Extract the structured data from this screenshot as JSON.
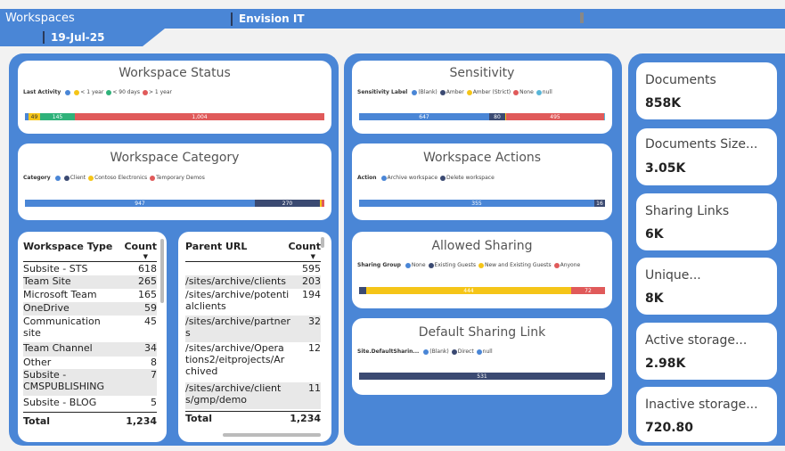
{
  "header": {
    "title": "Workspaces",
    "org": "Envision IT",
    "date": "19-Jul-25"
  },
  "colors": {
    "blue": "#4a86d6",
    "navy": "#3b4a72",
    "yellow": "#f5c518",
    "green": "#2fb27a",
    "red": "#e05a5a",
    "teal": "#58b6d8"
  },
  "workspace_status": {
    "title": "Workspace Status",
    "legend_label": "Last Activity",
    "legend_items": [
      "",
      "< 1 year",
      "< 90 days",
      "> 1 year"
    ],
    "bar_labels": [
      "49",
      "145",
      "1,004"
    ]
  },
  "workspace_category": {
    "title": "Workspace Category",
    "legend_label": "Category",
    "legend_items": [
      "",
      "Client",
      "Contoso Electronics",
      "Temporary Demos"
    ],
    "bar_labels": [
      "947",
      "270"
    ]
  },
  "sensitivity": {
    "title": "Sensitivity",
    "legend_label": "Sensitivity Label",
    "legend_items": [
      "(Blank)",
      "Amber",
      "Amber (Strict)",
      "None",
      "null"
    ],
    "bar_labels": [
      "647",
      "80",
      "495"
    ]
  },
  "workspace_actions": {
    "title": "Workspace Actions",
    "legend_label": "Action",
    "legend_items": [
      "Archive workspace",
      "Delete workspace"
    ],
    "bar_labels": [
      "355",
      "16"
    ]
  },
  "allowed_sharing": {
    "title": "Allowed Sharing",
    "legend_label": "Sharing Group",
    "legend_items": [
      "None",
      "Existing Guests",
      "New and Existing Guests",
      "Anyone"
    ],
    "bar_labels": [
      "444",
      "72"
    ]
  },
  "default_sharing": {
    "title": "Default Sharing Link",
    "legend_label": "Site.DefaultSharin...",
    "legend_items": [
      "(Blank)",
      "Direct",
      "null"
    ],
    "bar_labels": [
      "531"
    ]
  },
  "workspace_type_table": {
    "headers": [
      "Workspace Type",
      "Count"
    ],
    "rows": [
      [
        "Subsite - STS",
        "618"
      ],
      [
        "Team Site",
        "265"
      ],
      [
        "Microsoft Team",
        "165"
      ],
      [
        "OneDrive",
        "59"
      ],
      [
        "Communication site",
        "45"
      ],
      [
        "Team Channel",
        "34"
      ],
      [
        "Other",
        "8"
      ],
      [
        "Subsite - CMSPUBLISHING",
        "7"
      ],
      [
        "Subsite - BLOG",
        "5"
      ]
    ],
    "total": [
      "Total",
      "1,234"
    ]
  },
  "parent_url_table": {
    "headers": [
      "Parent URL",
      "Count"
    ],
    "rows": [
      [
        "",
        "595"
      ],
      [
        "/sites/archive/clients",
        "203"
      ],
      [
        "/sites/archive/potentialclients",
        "194"
      ],
      [
        "/sites/archive/partners",
        "32"
      ],
      [
        "/sites/archive/Operations2/eitprojects/Archived",
        "12"
      ],
      [
        "/sites/archive/clients/gmp/demo",
        "11"
      ]
    ],
    "total": [
      "Total",
      "1,234"
    ]
  },
  "kpis": [
    {
      "label": "Documents",
      "value": "858K"
    },
    {
      "label": "Documents Size...",
      "value": "3.05K"
    },
    {
      "label": "Sharing Links",
      "value": "6K"
    },
    {
      "label": "Unique...",
      "value": "8K"
    },
    {
      "label": "Active storage...",
      "value": "2.98K"
    },
    {
      "label": "Inactive storage...",
      "value": "720.80"
    }
  ]
}
